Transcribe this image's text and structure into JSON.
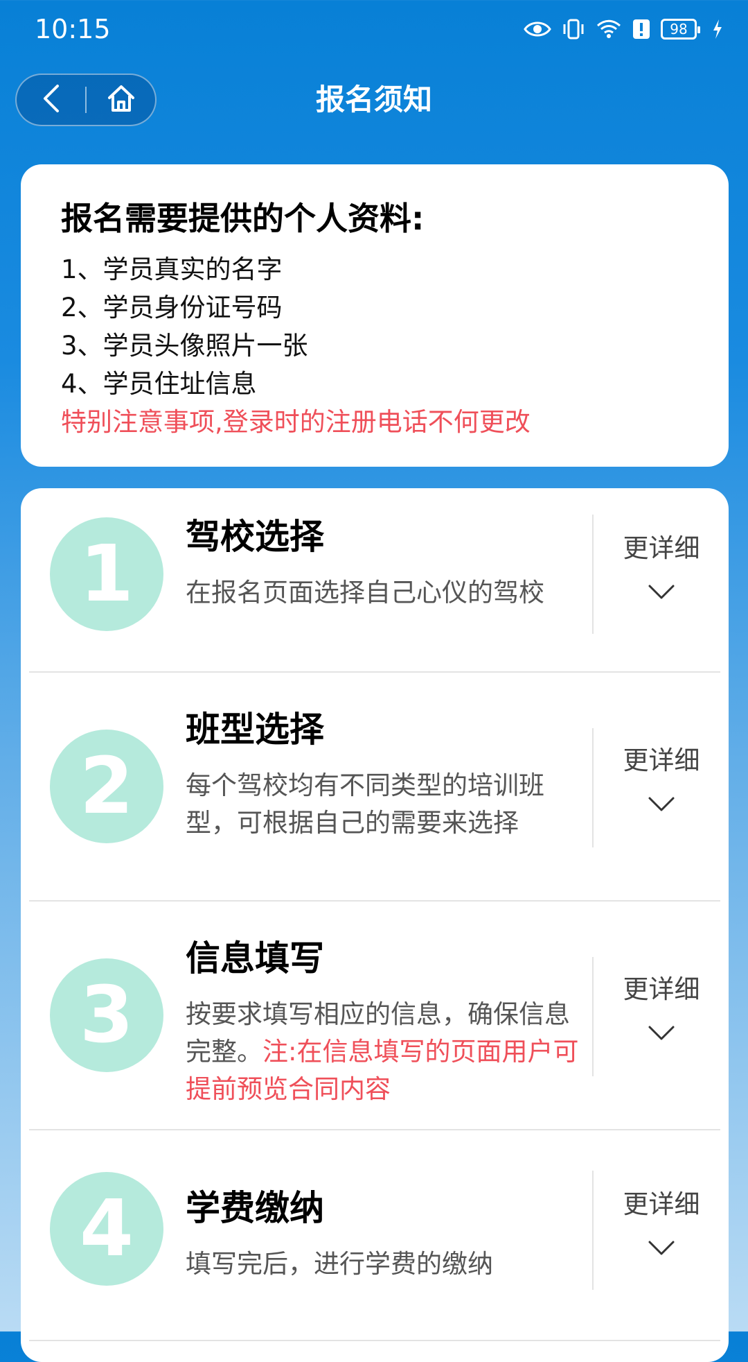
{
  "status_bar": {
    "time": "10:15",
    "battery": "98",
    "icons": [
      "eye-icon",
      "vibrate-icon",
      "wifi-icon",
      "alert-icon",
      "battery-icon",
      "charging-icon"
    ]
  },
  "nav": {
    "title": "报名须知",
    "back_icon": "chevron-left-icon",
    "home_icon": "home-icon"
  },
  "info": {
    "title": "报名需要提供的个人资料:",
    "items": [
      "1、学员真实的名字",
      "2、学员身份证号码",
      "3、学员头像照片一张",
      "4、学员住址信息"
    ],
    "warning": "特别注意事项,登录时的注册电话不何更改"
  },
  "steps": [
    {
      "number": "1",
      "title": "驾校选择",
      "desc": "在报名页面选择自己心仪的驾校",
      "note": "",
      "more": "更详细"
    },
    {
      "number": "2",
      "title": "班型选择",
      "desc": "每个驾校均有不同类型的培训班型，可根据自己的需要来选择",
      "note": "",
      "more": "更详细"
    },
    {
      "number": "3",
      "title": "信息填写",
      "desc": "按要求填写相应的信息，确保信息完整。",
      "note": "注:在信息填写的页面用户可提前预览合同内容",
      "more": "更详细"
    },
    {
      "number": "4",
      "title": "学费缴纳",
      "desc": "填写完后，进行学费的缴纳",
      "note": "",
      "more": "更详细"
    }
  ],
  "colors": {
    "header_blue": "#0880d6",
    "circle_mint": "#b5eadc",
    "warning_red": "#ef4f59"
  }
}
